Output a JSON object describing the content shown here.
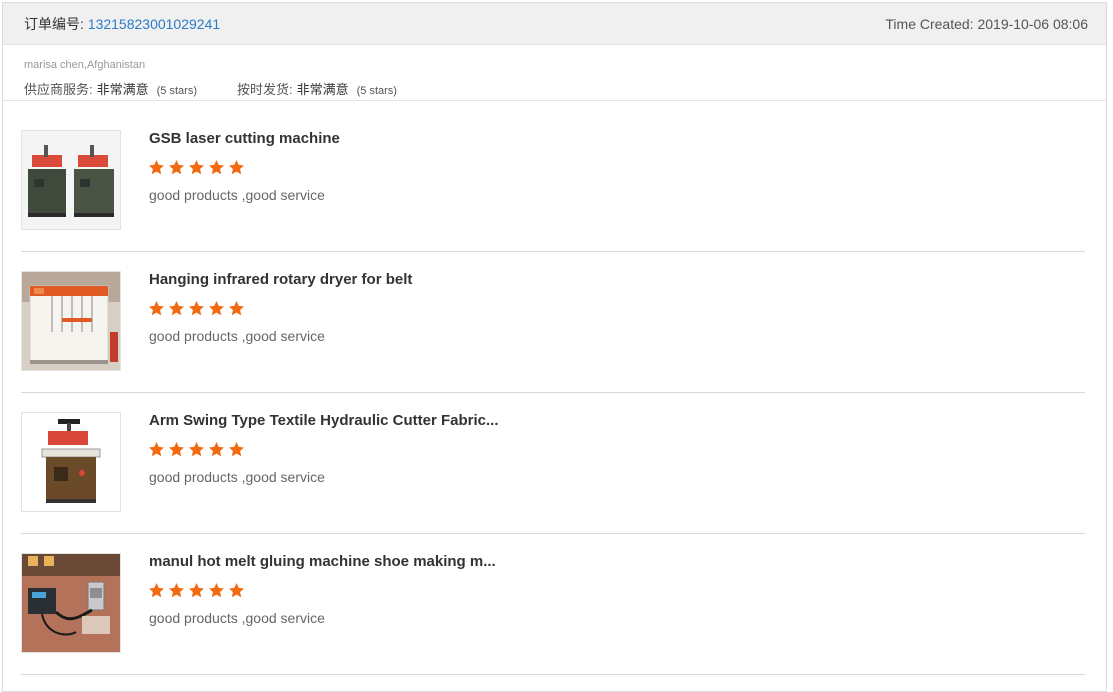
{
  "header": {
    "order_label": "订单编号:",
    "order_number": "13215823001029241",
    "time_created": "Time Created: 2019-10-06 08:06"
  },
  "buyer": "marisa chen,Afghanistan",
  "ratings": [
    {
      "label": "供应商服务:",
      "value": "非常满意",
      "stars": "(5 stars)"
    },
    {
      "label": "按时发货:",
      "value": "非常满意",
      "stars": "(5 stars)"
    }
  ],
  "star_color": "#f26a10",
  "items": [
    {
      "title": "GSB laser cutting machine",
      "rating": 5,
      "comment": "good products ,good service",
      "image": "hydraulic-press-pair-photo"
    },
    {
      "title": "Hanging infrared rotary dryer for belt",
      "rating": 5,
      "comment": "good products ,good service",
      "image": "infrared-dryer-cabinet-photo"
    },
    {
      "title": "Arm Swing Type Textile Hydraulic Cutter Fabric...",
      "rating": 5,
      "comment": "good products ,good service",
      "image": "swing-arm-cutter-photo"
    },
    {
      "title": "manul hot melt gluing machine shoe making m...",
      "rating": 5,
      "comment": "good products ,good service",
      "image": "gluing-machine-photo"
    }
  ]
}
